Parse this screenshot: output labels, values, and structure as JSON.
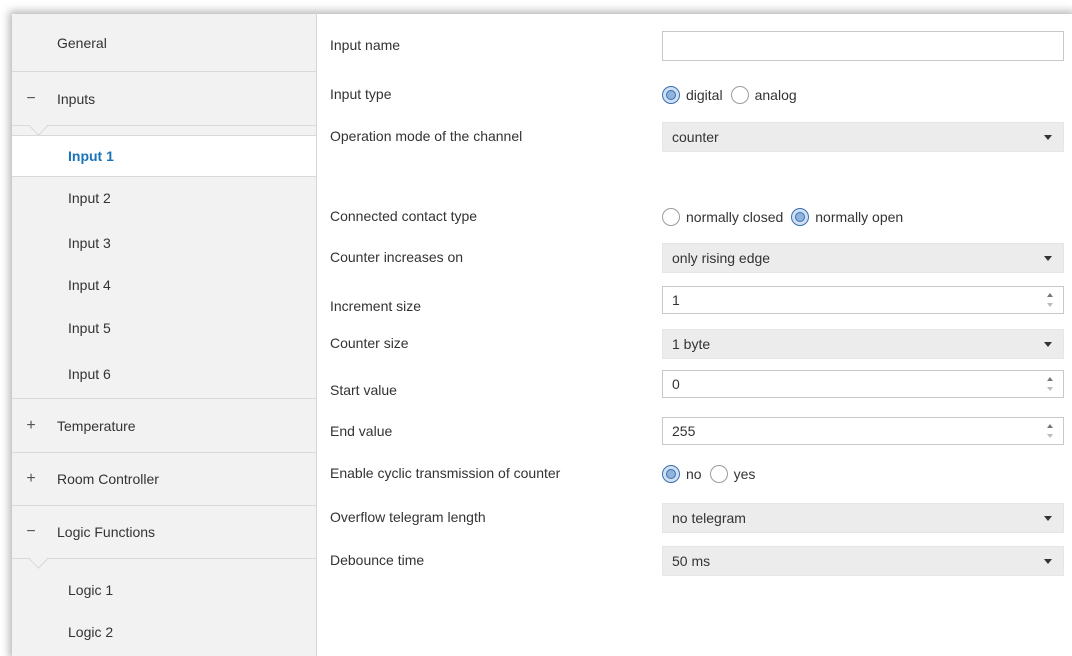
{
  "sidebar": {
    "general": "General",
    "inputs": {
      "label": "Inputs",
      "sign": "−"
    },
    "input_items": [
      "Input 1",
      "Input 2",
      "Input 3",
      "Input 4",
      "Input 5",
      "Input 6"
    ],
    "selected_item": "Input 1",
    "temperature": {
      "label": "Temperature",
      "sign": "+"
    },
    "room_controller": {
      "label": "Room Controller",
      "sign": "+"
    },
    "logic_functions": {
      "label": "Logic Functions",
      "sign": "−"
    },
    "logic_items": [
      "Logic 1",
      "Logic 2"
    ]
  },
  "form": {
    "input_name": {
      "label": "Input name",
      "value": ""
    },
    "input_type": {
      "label": "Input type",
      "options": [
        "digital",
        "analog"
      ],
      "selected": "digital"
    },
    "operation_mode": {
      "label": "Operation mode of the channel",
      "value": "counter"
    },
    "contact_type": {
      "label": "Connected contact type",
      "options": [
        "normally closed",
        "normally open"
      ],
      "selected": "normally open"
    },
    "counter_increases": {
      "label": "Counter increases on",
      "value": "only rising edge"
    },
    "increment_size": {
      "label": "Increment size",
      "value": "1"
    },
    "counter_size": {
      "label": "Counter size",
      "value": "1 byte"
    },
    "start_value": {
      "label": "Start value",
      "value": "0"
    },
    "end_value": {
      "label": "End value",
      "value": "255"
    },
    "cyclic_transmission": {
      "label": "Enable cyclic transmission of counter",
      "options": [
        "no",
        "yes"
      ],
      "selected": "no"
    },
    "overflow_length": {
      "label": "Overflow telegram length",
      "value": "no telegram"
    },
    "debounce_time": {
      "label": "Debounce time",
      "value": "50 ms"
    }
  },
  "colors": {
    "accent": "#1a73b8",
    "sidebar_bg": "#f2f2f2",
    "select_bg": "#ececec"
  }
}
